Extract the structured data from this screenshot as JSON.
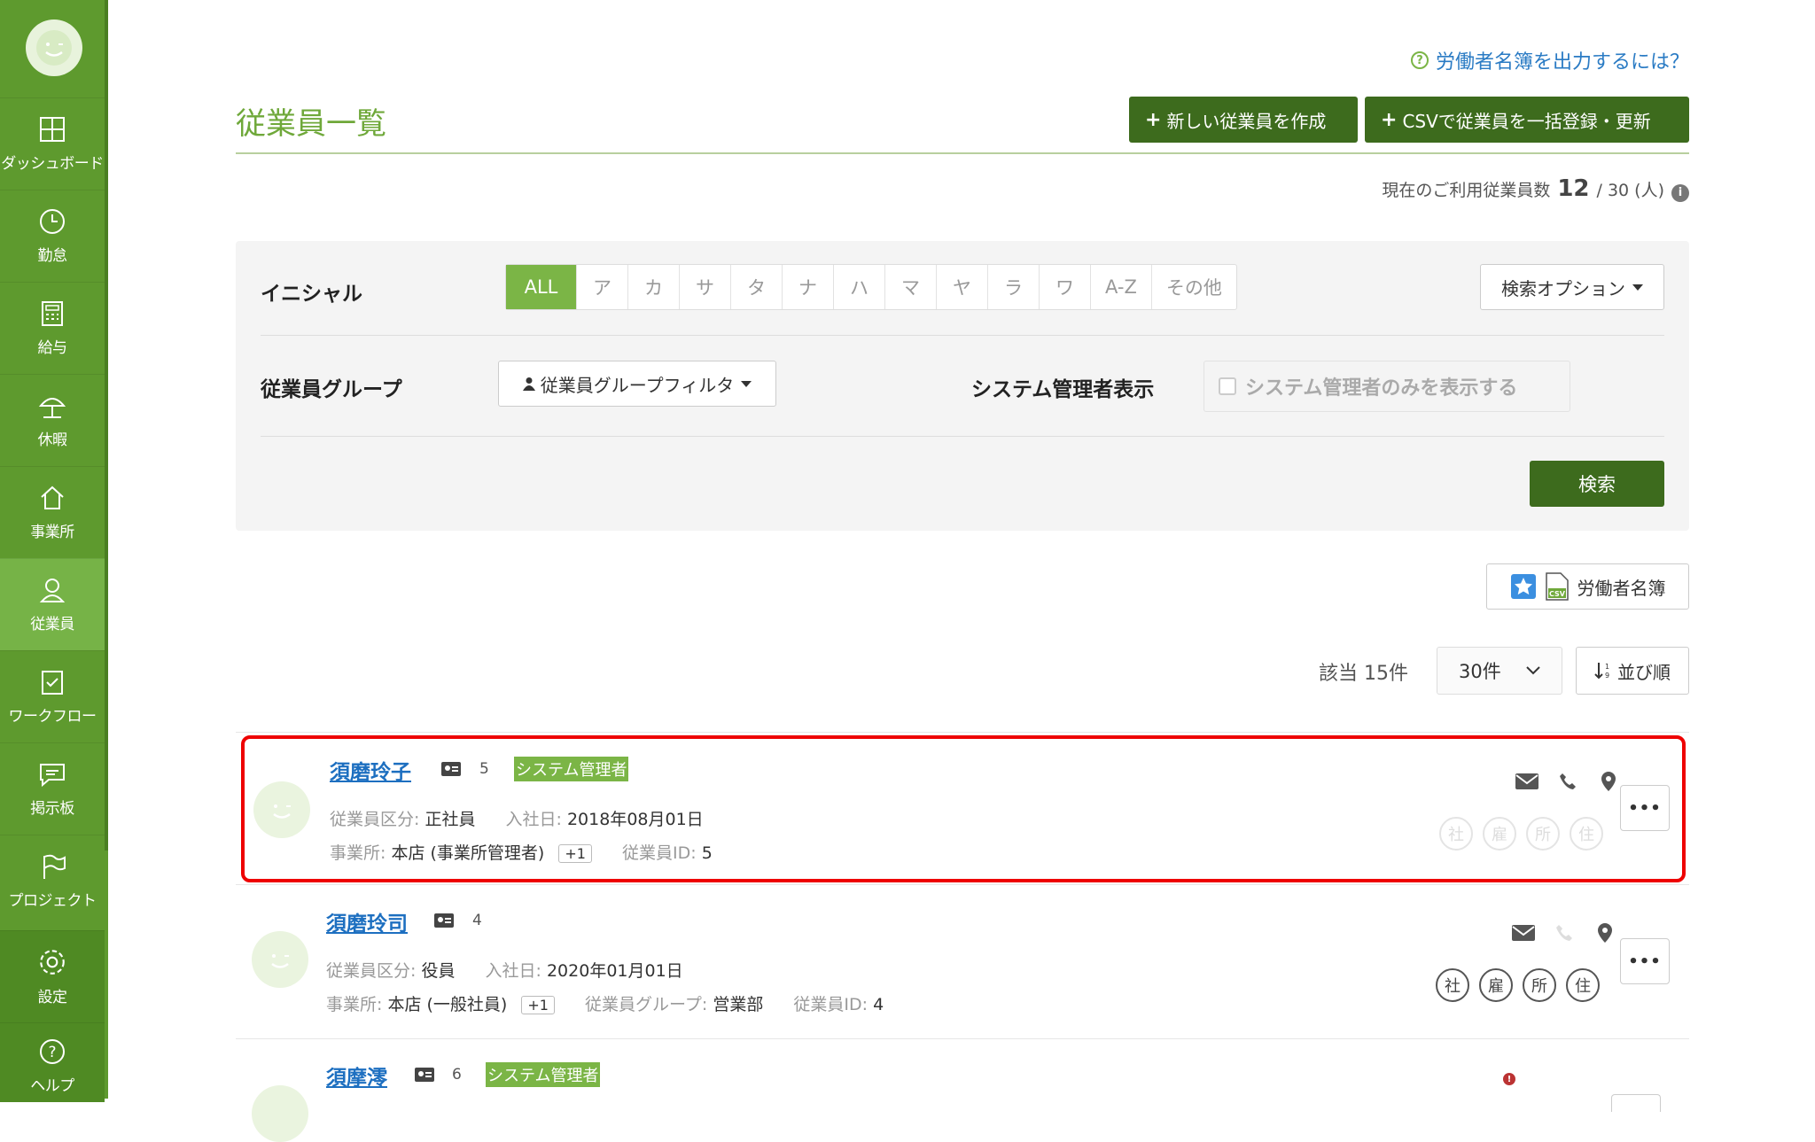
{
  "sidebar": {
    "items": [
      {
        "label": "ダッシュボード",
        "icon": "dashboard-icon"
      },
      {
        "label": "勤怠",
        "icon": "clock-icon"
      },
      {
        "label": "給与",
        "icon": "calculator-icon"
      },
      {
        "label": "休暇",
        "icon": "umbrella-icon"
      },
      {
        "label": "事業所",
        "icon": "home-icon"
      },
      {
        "label": "従業員",
        "icon": "user-icon",
        "active": true
      },
      {
        "label": "ワークフロー",
        "icon": "clipboard-icon"
      },
      {
        "label": "掲示板",
        "icon": "chat-icon"
      },
      {
        "label": "プロジェクト",
        "icon": "flag-icon"
      },
      {
        "label": "設定",
        "icon": "gear-icon"
      },
      {
        "label": "ヘルプ",
        "icon": "help-icon"
      }
    ]
  },
  "header": {
    "help_link": "労働者名簿を出力するには？",
    "title": "従業員一覧",
    "new_button": "新しい従業員を作成",
    "csv_button": "CSVで従業員を一括登録・更新",
    "usage_label": "現在のご利用従業員数",
    "usage_current": "12",
    "usage_rest": "/ 30 (人)"
  },
  "filter": {
    "initial_label": "イニシャル",
    "initials": [
      "ALL",
      "ア",
      "カ",
      "サ",
      "タ",
      "ナ",
      "ハ",
      "マ",
      "ヤ",
      "ラ",
      "ワ",
      "A-Z",
      "その他"
    ],
    "search_options": "検索オプション",
    "group_label": "従業員グループ",
    "group_filter": "従業員グループフィルタ",
    "admin_label": "システム管理者表示",
    "admin_checkbox": "システム管理者のみを表示する",
    "search_button": "検索"
  },
  "toolbar": {
    "roster_button": "労働者名簿",
    "count": "該当 15件",
    "per_page": "30件",
    "sort": "並び順"
  },
  "employees": [
    {
      "name": "須磨玲子",
      "num": "5",
      "tag": "システム管理者",
      "type_label": "従業員区分:",
      "type": "正社員",
      "join_label": "入社日:",
      "join": "2018年08月01日",
      "office_label": "事業所:",
      "office": "本店 (事業所管理者)",
      "office_extra": "+1",
      "id_label": "従業員ID:",
      "id": "5",
      "badges": [
        "社",
        "雇",
        "所",
        "住"
      ]
    },
    {
      "name": "須磨玲司",
      "num": "4",
      "type_label": "従業員区分:",
      "type": "役員",
      "join_label": "入社日:",
      "join": "2020年01月01日",
      "office_label": "事業所:",
      "office": "本店 (一般社員)",
      "office_extra": "+1",
      "group_label": "従業員グループ:",
      "group": "営業部",
      "id_label": "従業員ID:",
      "id": "4",
      "badges": [
        "社",
        "雇",
        "所",
        "住"
      ]
    },
    {
      "name": "須摩澪",
      "num": "6",
      "tag": "システム管理者"
    }
  ],
  "colors": {
    "sidebar": "#5e9a2e",
    "accent": "#7bb546",
    "dark_button": "#3d6b1d",
    "link": "#1d6fc0",
    "highlight": "#ee0000"
  }
}
